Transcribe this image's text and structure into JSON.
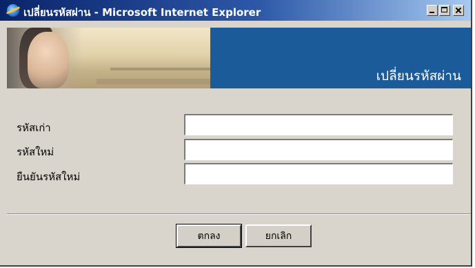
{
  "window": {
    "title": "เปลี่ยนรหัสผ่าน - Microsoft Internet Explorer",
    "controls": {
      "minimize": "minimize",
      "maximize": "maximize",
      "close": "close"
    }
  },
  "banner": {
    "title": "เปลี่ยนรหัสผ่าน"
  },
  "form": {
    "fields": [
      {
        "label": "รหัสเก่า",
        "value": ""
      },
      {
        "label": "รหัสใหม่",
        "value": ""
      },
      {
        "label": "ยืนยันรหัสใหม่",
        "value": ""
      }
    ]
  },
  "buttons": {
    "ok": "ตกลง",
    "cancel": "ยกเลิก"
  },
  "colors": {
    "titlebar_start": "#0a246a",
    "titlebar_end": "#a6caf0",
    "banner_blue": "#1b5b9a",
    "background": "#d9d5cc"
  },
  "icons": {
    "app": "internet-explorer-icon"
  }
}
